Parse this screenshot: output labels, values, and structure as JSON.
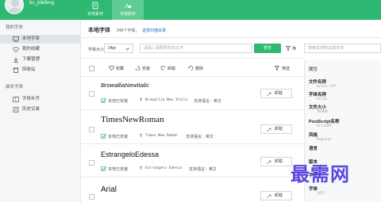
{
  "header": {
    "username": "bu_jidefeng",
    "tabs": [
      {
        "label": "本地素材",
        "icon": "document-icon",
        "active": false
      },
      {
        "label": "字体助手",
        "icon": "font-icon",
        "active": true
      }
    ],
    "color": "#2eb872"
  },
  "sidebar": {
    "section1": "我的字体",
    "items1": [
      {
        "label": "本地字体",
        "icon": "monitor-icon",
        "active": true
      },
      {
        "label": "我的收藏",
        "icon": "heart-icon",
        "active": false
      },
      {
        "label": "下载管理",
        "icon": "download-icon",
        "active": false
      },
      {
        "label": "回收站",
        "icon": "trash-icon",
        "active": false
      }
    ],
    "section2": "装失字体",
    "items2": [
      {
        "label": "字体补齐",
        "icon": "font-fill-icon",
        "active": false
      },
      {
        "label": "历史记录",
        "icon": "history-icon",
        "active": false
      }
    ]
  },
  "main": {
    "title": "本地字体",
    "count_text": "249个字体，",
    "scan_link": "选择扫描目录",
    "size_label": "字体大小",
    "size_value": "24pt",
    "preview_placeholder": "请输入需要预览的文字",
    "preview_button": "预览",
    "filter_label": "筛",
    "search_placeholder": "搜索本地和云端字体"
  },
  "toolbar": {
    "items": [
      {
        "label": "收藏",
        "icon": "heart-outline-icon"
      },
      {
        "label": "安装",
        "icon": "install-icon"
      },
      {
        "label": "卸载",
        "icon": "uninstall-icon"
      },
      {
        "label": "删除",
        "icon": "delete-icon"
      }
    ],
    "filter_label": "筛选"
  },
  "fonts": [
    {
      "name": "BrowalliaNewItalic",
      "status": "本地已安装",
      "sample": "Browallia New Italic",
      "lang": "支持语言：英文",
      "button": "卸载"
    },
    {
      "name": "TimesNewRoman",
      "status": "本地已安装",
      "sample": "Times New Roman",
      "lang": "支持语言：英文",
      "button": "卸载"
    },
    {
      "name": "EstrangeloEdessa",
      "status": "本地已安装",
      "sample": "Estrangelo Edessa",
      "lang": "支持语言：英文",
      "button": "卸载"
    },
    {
      "name": "Arial",
      "button": "卸载"
    }
  ],
  "properties": {
    "title": "属性",
    "rows": [
      {
        "label": "文件名称",
        "value": "arial.ttf"
      },
      {
        "label": "字体名称",
        "value": "Arial"
      },
      {
        "label": "文件大小",
        "value": "763KB"
      },
      {
        "label": "PostScript名称",
        "value": "ArialMT"
      },
      {
        "label": "风格",
        "value": "Regular"
      },
      {
        "label": "语言",
        "value": ""
      },
      {
        "label": "版本",
        "value": ""
      },
      {
        "label": "字符",
        "value": ""
      },
      {
        "label": "字体",
        "value": "3417"
      }
    ]
  },
  "watermark": "最需网"
}
